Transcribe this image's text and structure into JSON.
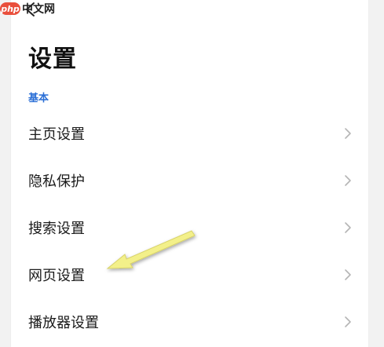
{
  "watermark": {
    "logo": "php",
    "text": "中文网"
  },
  "header": {
    "title": "设置"
  },
  "section": {
    "label": "基本"
  },
  "menu": {
    "items": [
      {
        "label": "主页设置"
      },
      {
        "label": "隐私保护"
      },
      {
        "label": "搜索设置"
      },
      {
        "label": "网页设置"
      },
      {
        "label": "播放器设置"
      }
    ]
  },
  "icons": {
    "back": "back-arrow-icon",
    "chevron": "chevron-right-icon"
  },
  "colors": {
    "accent": "#2b6fd6",
    "annotation_arrow": "#f3f08a",
    "panel_bg": "#ffffff",
    "page_bg": "#f2f2f2"
  }
}
